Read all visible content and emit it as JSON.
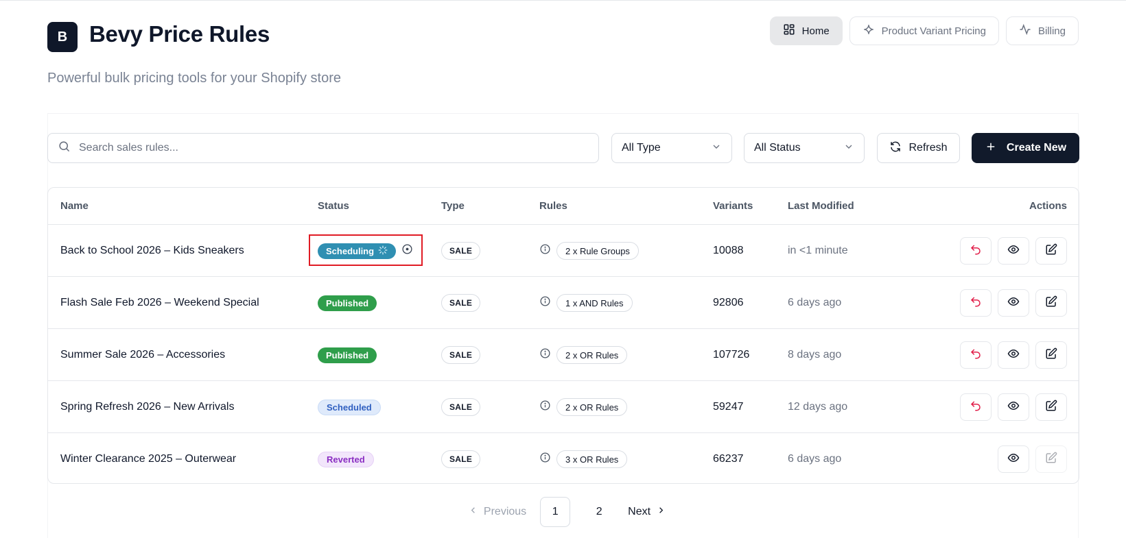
{
  "app": {
    "logo_letter": "B",
    "title": "Bevy Price Rules",
    "subtitle": "Powerful bulk pricing tools for your Shopify store"
  },
  "nav": {
    "home": "Home",
    "variant_pricing": "Product Variant Pricing",
    "billing": "Billing"
  },
  "toolbar": {
    "search_placeholder": "Search sales rules...",
    "type_filter": "All Type",
    "status_filter": "All Status",
    "refresh_label": "Refresh",
    "create_label": "Create New"
  },
  "table": {
    "headers": {
      "name": "Name",
      "status": "Status",
      "type": "Type",
      "rules": "Rules",
      "variants": "Variants",
      "last_modified": "Last Modified",
      "actions": "Actions"
    },
    "rows": [
      {
        "name": "Back to School 2026 – Kids Sneakers",
        "status": "Scheduling",
        "status_kind": "scheduling",
        "type": "SALE",
        "rules": "2 x Rule Groups",
        "variants": "10088",
        "modified": "in <1 minute",
        "can_revert": true,
        "can_edit": true
      },
      {
        "name": "Flash Sale Feb 2026 – Weekend Special",
        "status": "Published",
        "status_kind": "published",
        "type": "SALE",
        "rules": "1 x AND Rules",
        "variants": "92806",
        "modified": "6 days ago",
        "can_revert": true,
        "can_edit": true
      },
      {
        "name": "Summer Sale 2026 – Accessories",
        "status": "Published",
        "status_kind": "published",
        "type": "SALE",
        "rules": "2 x OR Rules",
        "variants": "107726",
        "modified": "8 days ago",
        "can_revert": true,
        "can_edit": true
      },
      {
        "name": "Spring Refresh 2026 – New Arrivals",
        "status": "Scheduled",
        "status_kind": "scheduled",
        "type": "SALE",
        "rules": "2 x OR Rules",
        "variants": "59247",
        "modified": "12 days ago",
        "can_revert": true,
        "can_edit": true
      },
      {
        "name": "Winter Clearance 2025 – Outerwear",
        "status": "Reverted",
        "status_kind": "reverted",
        "type": "SALE",
        "rules": "3 x OR Rules",
        "variants": "66237",
        "modified": "6 days ago",
        "can_revert": false,
        "can_edit": false
      }
    ]
  },
  "pagination": {
    "previous": "Previous",
    "pages": [
      "1",
      "2"
    ],
    "current": "1",
    "next": "Next"
  },
  "colors": {
    "brand_dark": "#111a2b",
    "scheduling": "#2f8fb2",
    "published": "#2f9e4b",
    "scheduled": "#2f5fc0",
    "reverted": "#8a2ec2",
    "revert_icon": "#e11d48",
    "highlight": "#e01b24"
  },
  "icons": {
    "nav_home": "grid-icon",
    "nav_variant": "sparkle-icon",
    "nav_billing": "activity-icon",
    "search": "search-icon",
    "dropdown": "chevron-down-icon",
    "refresh": "refresh-icon",
    "create": "plus-icon",
    "rules_info": "info-icon",
    "row_revert": "undo-icon",
    "row_view": "eye-icon",
    "row_edit": "edit-icon"
  }
}
